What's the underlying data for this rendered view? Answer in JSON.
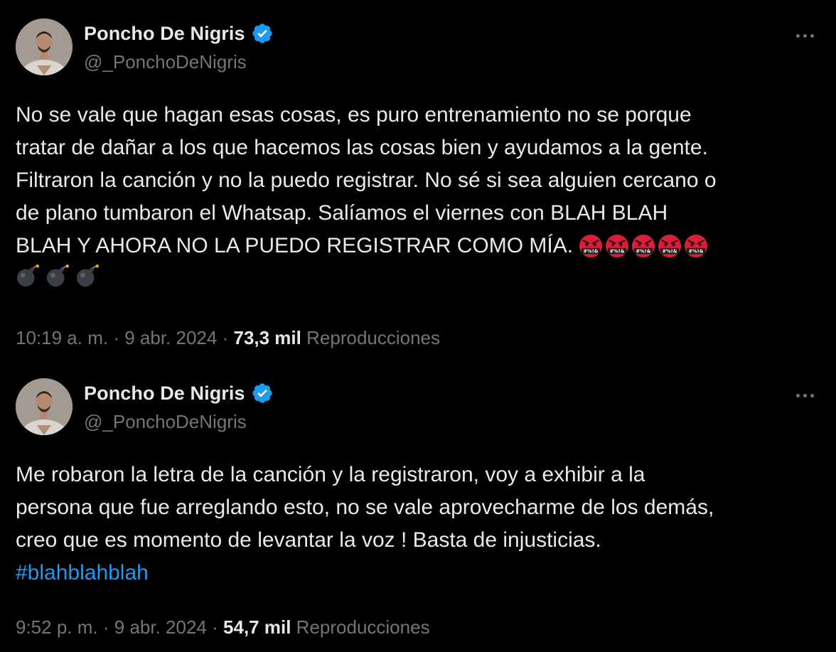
{
  "tweets": [
    {
      "author": {
        "display_name": "Poncho De Nigris",
        "handle": "@_PonchoDeNigris",
        "verified": true
      },
      "text_lines": [
        "No se vale que hagan esas cosas, es puro entrenamiento no se porque",
        "tratar de dañar a los que hacemos las cosas bien y ayudamos a la gente.",
        "Filtraron la canción y no la puedo registrar. No sé si sea alguien cercano o",
        "de plano tumbaron el Whatsap. Salíamos el viernes con BLAH BLAH",
        "BLAH Y AHORA NO LA PUEDO REGISTRAR COMO MÍA. "
      ],
      "emojis": {
        "angry_face_with_symbols": 5,
        "angry_symbol_text": "#%!&",
        "bomb": 3
      },
      "time": "10:19 a. m.",
      "date": "9 abr. 2024",
      "views_count": "73,3 mil",
      "views_label": "Reproducciones"
    },
    {
      "author": {
        "display_name": "Poncho De Nigris",
        "handle": "@_PonchoDeNigris",
        "verified": true
      },
      "text_lines": [
        "Me robaron la letra de la canción y la registraron, voy a exhibir a la",
        "persona que fue arreglando esto, no se vale aprovecharme de los demás,",
        "creo que es momento de levantar la voz ! Basta de injusticias."
      ],
      "hashtag": "#blahblahblah",
      "time": "9:52 p. m.",
      "date": "9 abr. 2024",
      "views_count": "54,7 mil",
      "views_label": "Reproducciones"
    }
  ],
  "separator": "·",
  "colors": {
    "background": "#000000",
    "primary_text": "#e7e9ea",
    "secondary_text": "#71767b",
    "link": "#1d9bf0",
    "verified_badge": "#1d9bf0",
    "angry_emoji": "#d81f3a"
  },
  "icons": [
    "avatar",
    "verified-badge-icon",
    "more-options-icon",
    "angry-face-with-symbols-icon",
    "bomb-icon"
  ]
}
